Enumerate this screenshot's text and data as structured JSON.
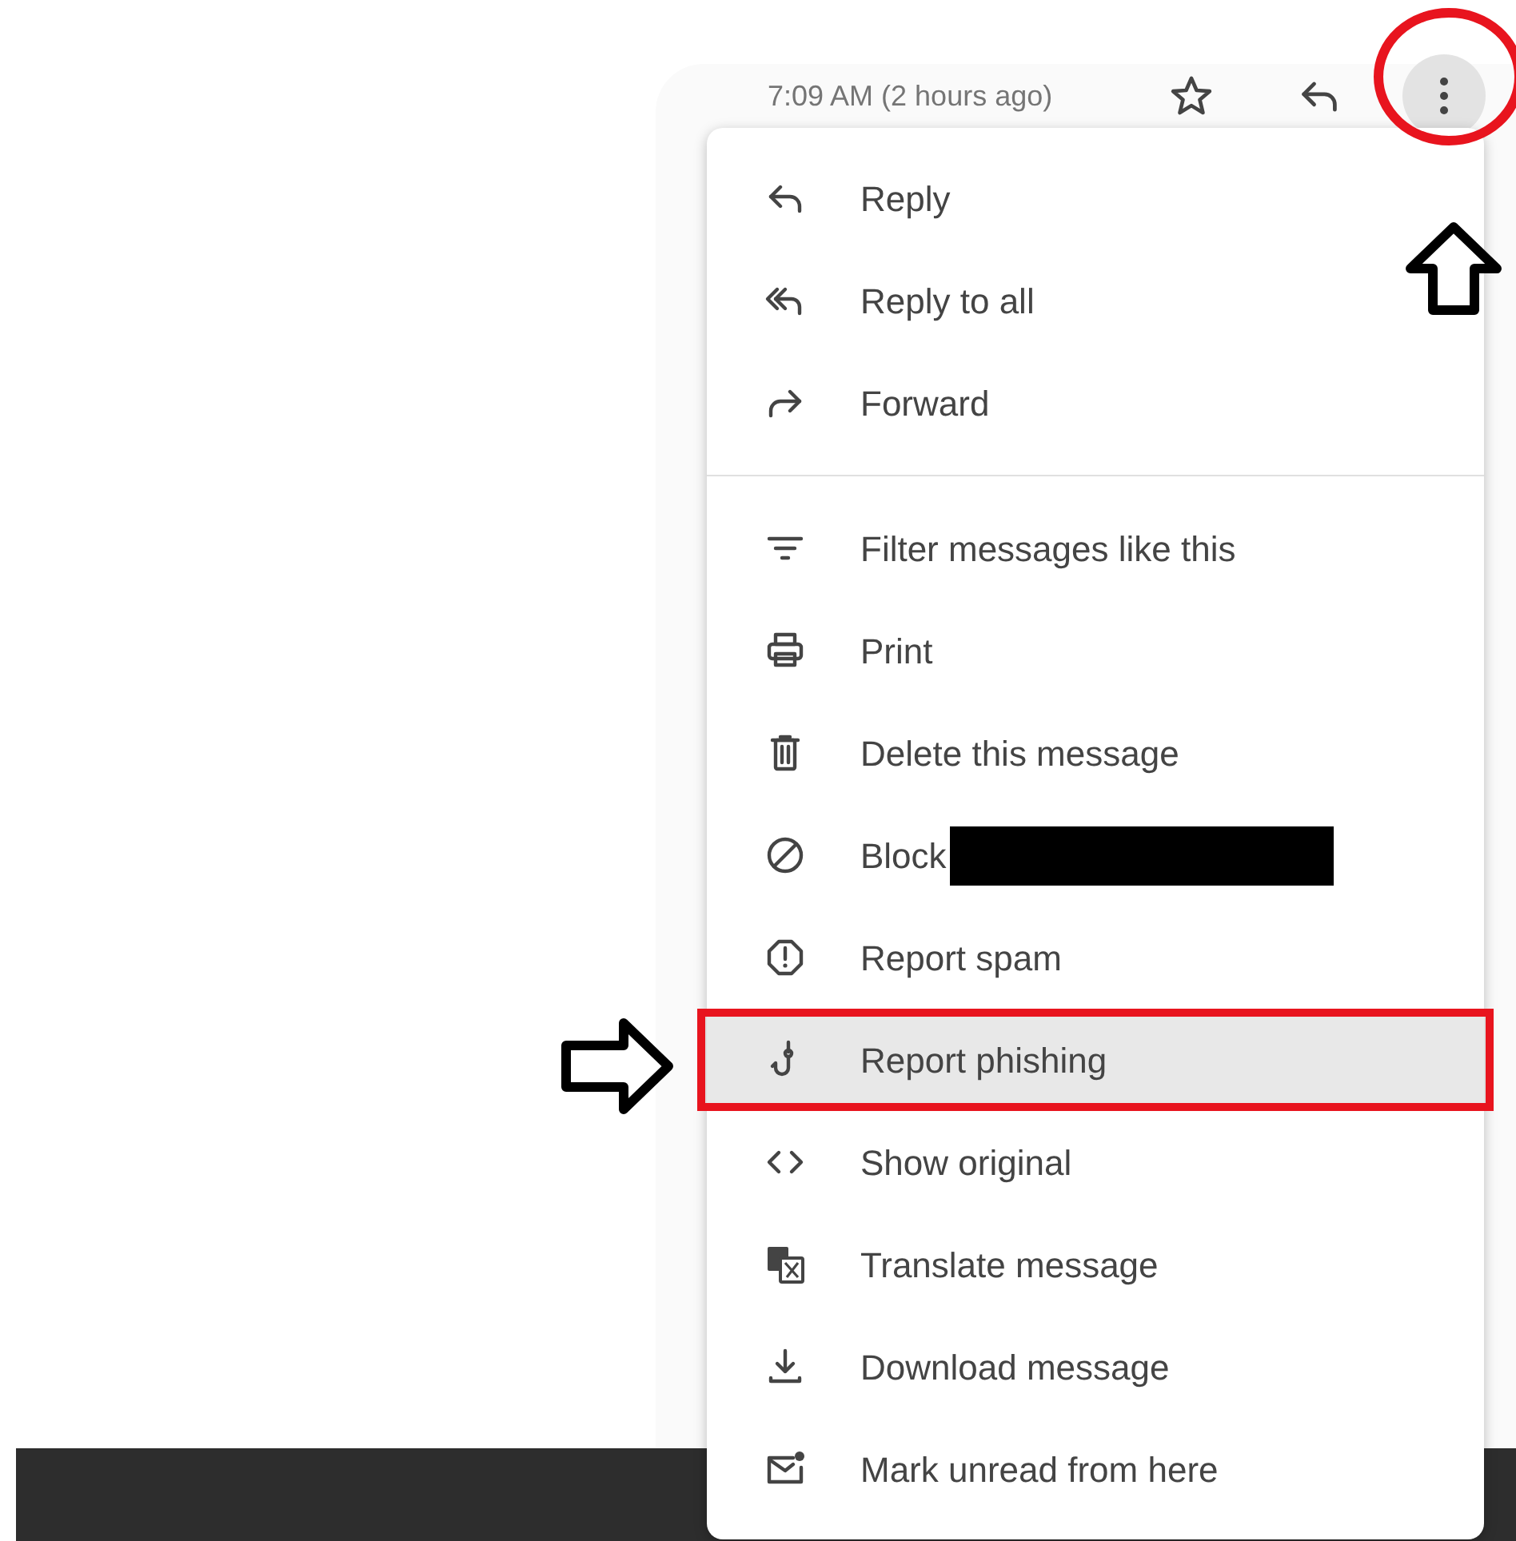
{
  "header": {
    "timestamp": "7:09 AM (2 hours ago)",
    "starred": false
  },
  "menu": {
    "groups": [
      [
        {
          "label": "Reply",
          "selected": false
        },
        {
          "label": "Reply to all",
          "selected": false
        },
        {
          "label": "Forward",
          "selected": false
        }
      ],
      [
        {
          "label": "Filter messages like this",
          "selected": false
        },
        {
          "label": "Print",
          "selected": false
        },
        {
          "label": "Delete this message",
          "selected": false
        },
        {
          "label": "Block",
          "selected": false,
          "redacted": true
        },
        {
          "label": "Report spam",
          "selected": false
        },
        {
          "label": "Report phishing",
          "selected": true
        },
        {
          "label": "Show original",
          "selected": false
        },
        {
          "label": "Translate message",
          "selected": false
        },
        {
          "label": "Download message",
          "selected": false
        },
        {
          "label": "Mark unread from here",
          "selected": false
        }
      ]
    ]
  },
  "annotations": [
    {
      "kind": "circle"
    },
    {
      "kind": "up-arrow"
    },
    {
      "kind": "right-arrow"
    },
    {
      "kind": "box"
    }
  ]
}
